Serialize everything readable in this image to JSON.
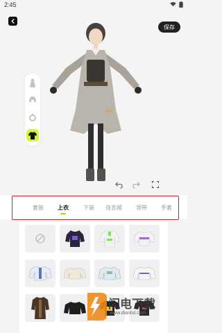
{
  "status": {
    "time": "2:45"
  },
  "header": {
    "save_label": "保存"
  },
  "toolbar": {
    "items": [
      {
        "name": "body-tool",
        "icon": "person-icon"
      },
      {
        "name": "hair-tool",
        "icon": "hair-icon"
      },
      {
        "name": "accessory-tool",
        "icon": "ring-icon"
      },
      {
        "name": "clothing-tool",
        "icon": "shirt-icon",
        "active": true
      }
    ],
    "accent": "#d9f23a"
  },
  "tabs": [
    {
      "label": "套装"
    },
    {
      "label": "上衣",
      "active": true
    },
    {
      "label": "下装"
    },
    {
      "label": "连衣裙"
    },
    {
      "label": "领带"
    },
    {
      "label": "手套"
    }
  ],
  "watermark": {
    "brand": "闪电下载",
    "url": "www.dianlut.com"
  },
  "colors": {
    "tab_accent": "#b8d400",
    "highlight_outline": "#e02020"
  }
}
